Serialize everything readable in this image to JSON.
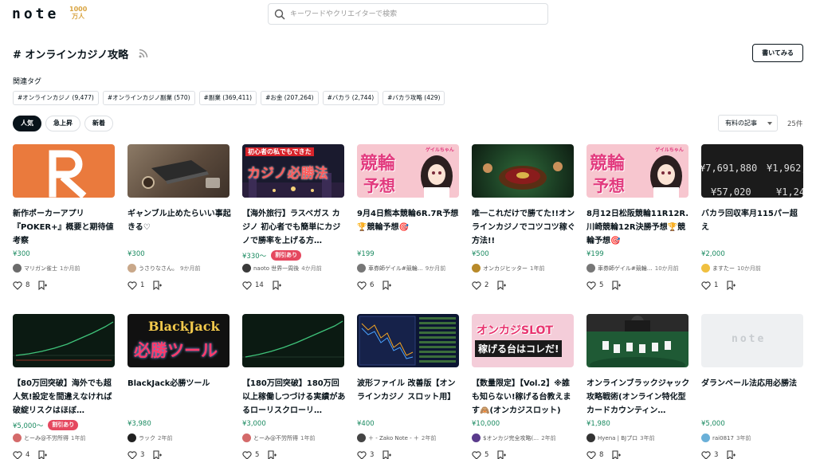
{
  "header": {
    "logo": "note",
    "badge_number": "1000",
    "badge_unit": "万人",
    "search_placeholder": "キーワードやクリエイターで検索"
  },
  "page": {
    "title": "# オンラインカジノ攻略",
    "write_button": "書いてみる",
    "related_label": "関連タグ",
    "tags": [
      "#オンラインカジノ (9,477)",
      "#オンラインカジノ副業 (570)",
      "#副業 (369,411)",
      "#お金 (207,264)",
      "#バカラ (2,744)",
      "#バカラ攻略 (429)"
    ],
    "sort_tabs": [
      "人気",
      "急上昇",
      "新着"
    ],
    "active_sort": "人気",
    "filter_select": "有料の記事",
    "count": "25件"
  },
  "thumb_text": {
    "t3_top": "初心者の私でもできた",
    "t3_main": "カジノ必勝法",
    "t4_main1": "競輪",
    "t4_main2": "予想",
    "t4_small": "ゲイルちゃん",
    "t6_num1": "¥7,691,880",
    "t6_num2": "¥1,962,248",
    "t6_num3": "¥57,020",
    "t6_num4": "¥1,240",
    "t8_l1": "BlackJack",
    "t8_l2": "必勝ツール",
    "t11_l1": "オンカジSLOT",
    "t11_l2": "稼げる台はコレだ!",
    "t14_logo": "note"
  },
  "colors": {
    "accent": "#1a8a60",
    "badge": "#e5485f",
    "dark": "#08131a"
  },
  "row1": [
    {
      "title": "新作ポーカーアプリ『POKER+』概要と期待値考察",
      "price": "¥300",
      "discount": "",
      "author": "マリガン雀士",
      "time": "1か月前",
      "likes": "8",
      "avatar": "#6b6b6b"
    },
    {
      "title": "ギャンブル止めたらいい事起きる♡",
      "price": "¥300",
      "discount": "",
      "author": "うさりなさん。",
      "time": "9か月前",
      "likes": "1",
      "avatar": "#c9a88a"
    },
    {
      "title": "【海外旅行】ラスベガス カジノ 初心者でも簡単にカジノで勝率を上げる方…",
      "price": "¥330〜",
      "discount": "割引あり",
      "author": "naoto 世界一周後",
      "time": "4か月前",
      "likes": "14",
      "avatar": "#3a3a3a"
    },
    {
      "title": "9月4日熊本競輪6R.7R予想🏆競輪予想🎯",
      "price": "¥199",
      "discount": "",
      "author": "車券師ゲイル#競輪…",
      "time": "9か月前",
      "likes": "6",
      "avatar": "#777"
    },
    {
      "title": "唯一これだけで勝てた!!オンラインカジノでコツコツ稼ぐ方法!!",
      "price": "¥500",
      "discount": "",
      "author": "オンカジヒッター",
      "time": "1年前",
      "likes": "2",
      "avatar": "#b88a2a"
    },
    {
      "title": "8月12日松阪競輪11R12R.川崎競輪12R決勝予想🏆競輪予想🎯",
      "price": "¥199",
      "discount": "",
      "author": "車券師ゲイル#競輪…",
      "time": "10か月前",
      "likes": "5",
      "avatar": "#777"
    },
    {
      "title": "バカラ回収率月115パー超え",
      "price": "¥2,000",
      "discount": "",
      "author": "ますたー",
      "time": "10か月前",
      "likes": "1",
      "avatar": "#f0c040"
    }
  ],
  "row2": [
    {
      "title": "【80万回突破】海外でも超人気!設定を間違えなければ破綻リスクはほぼ…",
      "price": "¥5,000〜",
      "discount": "割引あり",
      "author": "とーみ@不労所得",
      "time": "1年前",
      "likes": "4",
      "avatar": "#d46a6a"
    },
    {
      "title": "BlackJack必勝ツール",
      "price": "¥3,980",
      "discount": "",
      "author": "ラック",
      "time": "2年前",
      "likes": "3",
      "avatar": "#222"
    },
    {
      "title": "【180万回突破】180万回以上稼働しつづける実績があるローリスクローリ…",
      "price": "¥3,000",
      "discount": "",
      "author": "とーみ@不労所得",
      "time": "1年前",
      "likes": "5",
      "avatar": "#d46a6a"
    },
    {
      "title": "波形ファイル 改善版【オンラインカジノ スロット用】",
      "price": "¥400",
      "discount": "",
      "author": "＋ - Zako Note - ＋",
      "time": "2年前",
      "likes": "3",
      "avatar": "#444"
    },
    {
      "title": "【数量限定】【Vol.2】※誰も知らない!稼げる台教えます🙈(オンカジスロット)",
      "price": "¥10,000",
      "discount": "",
      "author": "$オンカジ完全攻略(…",
      "time": "2年前",
      "likes": "5",
      "avatar": "#5a3b8c"
    },
    {
      "title": "オンラインブラックジャック攻略戦術(オンライン特化型カードカウンティン…",
      "price": "¥1,980",
      "discount": "",
      "author": "Hyena | BJプロ",
      "time": "3年前",
      "likes": "8",
      "avatar": "#333"
    },
    {
      "title": "ダランベール法応用必勝法",
      "price": "¥5,000",
      "discount": "",
      "author": "rai0817",
      "time": "3年前",
      "likes": "3",
      "avatar": "#6ab0d8"
    }
  ]
}
